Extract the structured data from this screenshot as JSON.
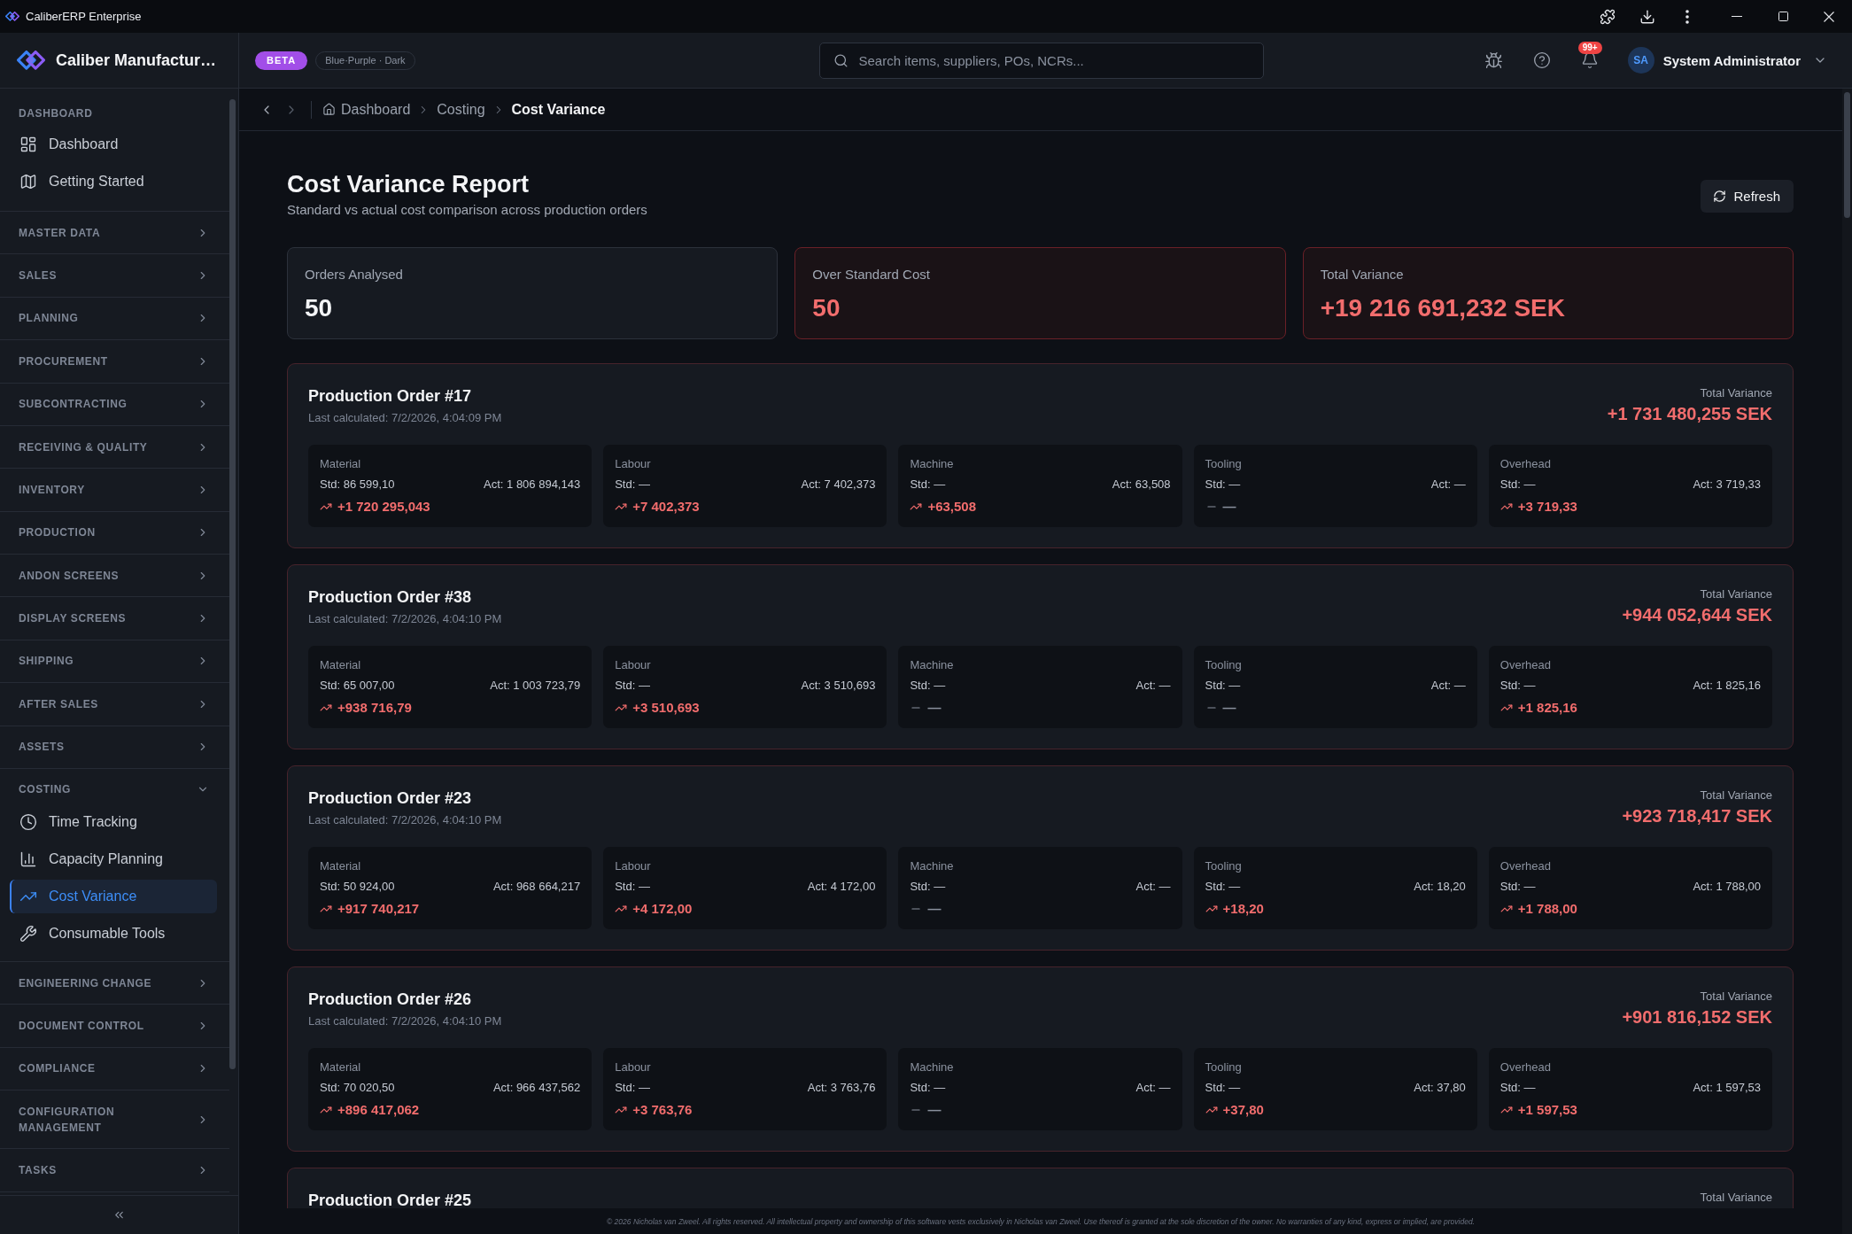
{
  "window": {
    "title": "CaliberERP Enterprise"
  },
  "sidebar": {
    "brand": "Caliber Manufactur…",
    "sections": [
      {
        "kind": "static",
        "label": "DASHBOARD",
        "items": [
          {
            "label": "Dashboard",
            "selected": false
          },
          {
            "label": "Getting Started",
            "selected": false
          }
        ]
      },
      {
        "kind": "group",
        "label": "MASTER DATA",
        "expanded": false
      },
      {
        "kind": "group",
        "label": "SALES",
        "expanded": false
      },
      {
        "kind": "group",
        "label": "PLANNING",
        "expanded": false
      },
      {
        "kind": "group",
        "label": "PROCUREMENT",
        "expanded": false
      },
      {
        "kind": "group",
        "label": "SUBCONTRACTING",
        "expanded": false
      },
      {
        "kind": "group",
        "label": "RECEIVING & QUALITY",
        "expanded": false
      },
      {
        "kind": "group",
        "label": "INVENTORY",
        "expanded": false
      },
      {
        "kind": "group",
        "label": "PRODUCTION",
        "expanded": false
      },
      {
        "kind": "group",
        "label": "ANDON SCREENS",
        "expanded": false
      },
      {
        "kind": "group",
        "label": "DISPLAY SCREENS",
        "expanded": false
      },
      {
        "kind": "group",
        "label": "SHIPPING",
        "expanded": false
      },
      {
        "kind": "group",
        "label": "AFTER SALES",
        "expanded": false
      },
      {
        "kind": "group",
        "label": "ASSETS",
        "expanded": false
      },
      {
        "kind": "group",
        "label": "COSTING",
        "expanded": true,
        "items": [
          {
            "label": "Time Tracking",
            "selected": false
          },
          {
            "label": "Capacity Planning",
            "selected": false
          },
          {
            "label": "Cost Variance",
            "selected": true
          },
          {
            "label": "Consumable Tools",
            "selected": false
          }
        ]
      },
      {
        "kind": "group",
        "label": "ENGINEERING CHANGE",
        "expanded": false
      },
      {
        "kind": "group",
        "label": "DOCUMENT CONTROL",
        "expanded": false
      },
      {
        "kind": "group",
        "label": "COMPLIANCE",
        "expanded": false
      },
      {
        "kind": "group",
        "label": "CONFIGURATION MANAGEMENT",
        "expanded": false
      },
      {
        "kind": "group",
        "label": "TASKS",
        "expanded": false
      }
    ]
  },
  "header": {
    "badge": "BETA",
    "theme_chip": "Blue·Purple · Dark",
    "search": {
      "placeholder": "Search items, suppliers, POs, NCRs..."
    },
    "notifications": {
      "count": "99+"
    },
    "user": {
      "initials": "SA",
      "name": "System Administrator"
    }
  },
  "breadcrumb": {
    "history": [
      {
        "kind": "back",
        "disabled": false
      },
      {
        "kind": "forward",
        "disabled": true
      }
    ],
    "items": [
      {
        "label": "Dashboard",
        "current": false
      },
      {
        "label": "Costing",
        "current": false
      },
      {
        "label": "Cost Variance",
        "current": true
      }
    ]
  },
  "page": {
    "title": "Cost Variance Report",
    "subtitle": "Standard vs actual cost comparison across production orders",
    "refresh_button": "Refresh"
  },
  "stats": [
    {
      "kind": "neutral",
      "label": "Orders Analysed",
      "value": "50"
    },
    {
      "kind": "alert",
      "label": "Over Standard Cost",
      "value": "50"
    },
    {
      "kind": "alert",
      "label": "Total Variance",
      "value": "+19 216 691,232 SEK"
    }
  ],
  "orders": [
    {
      "title": "Production Order #17",
      "last_calculated": "Last calculated: 7/2/2026, 4:04:09 PM",
      "total_label": "Total Variance",
      "total": "+1 731 480,255 SEK",
      "costs": [
        {
          "label": "Material",
          "std": "Std: 86 599,10",
          "act": "Act: 1 806 894,143",
          "kind": "increase",
          "variance": "+1 720 295,043"
        },
        {
          "label": "Labour",
          "std": "Std: —",
          "act": "Act: 7 402,373",
          "kind": "increase",
          "variance": "+7 402,373"
        },
        {
          "label": "Machine",
          "std": "Std: —",
          "act": "Act: 63,508",
          "kind": "increase",
          "variance": "+63,508"
        },
        {
          "label": "Tooling",
          "std": "Std: —",
          "act": "Act: —",
          "kind": "unchanged",
          "variance": "—"
        },
        {
          "label": "Overhead",
          "std": "Std: —",
          "act": "Act: 3 719,33",
          "kind": "increase",
          "variance": "+3 719,33"
        }
      ]
    },
    {
      "title": "Production Order #38",
      "last_calculated": "Last calculated: 7/2/2026, 4:04:10 PM",
      "total_label": "Total Variance",
      "total": "+944 052,644 SEK",
      "costs": [
        {
          "label": "Material",
          "std": "Std: 65 007,00",
          "act": "Act: 1 003 723,79",
          "kind": "increase",
          "variance": "+938 716,79"
        },
        {
          "label": "Labour",
          "std": "Std: —",
          "act": "Act: 3 510,693",
          "kind": "increase",
          "variance": "+3 510,693"
        },
        {
          "label": "Machine",
          "std": "Std: —",
          "act": "Act: —",
          "kind": "unchanged",
          "variance": "—"
        },
        {
          "label": "Tooling",
          "std": "Std: —",
          "act": "Act: —",
          "kind": "unchanged",
          "variance": "—"
        },
        {
          "label": "Overhead",
          "std": "Std: —",
          "act": "Act: 1 825,16",
          "kind": "increase",
          "variance": "+1 825,16"
        }
      ]
    },
    {
      "title": "Production Order #23",
      "last_calculated": "Last calculated: 7/2/2026, 4:04:10 PM",
      "total_label": "Total Variance",
      "total": "+923 718,417 SEK",
      "costs": [
        {
          "label": "Material",
          "std": "Std: 50 924,00",
          "act": "Act: 968 664,217",
          "kind": "increase",
          "variance": "+917 740,217"
        },
        {
          "label": "Labour",
          "std": "Std: —",
          "act": "Act: 4 172,00",
          "kind": "increase",
          "variance": "+4 172,00"
        },
        {
          "label": "Machine",
          "std": "Std: —",
          "act": "Act: —",
          "kind": "unchanged",
          "variance": "—"
        },
        {
          "label": "Tooling",
          "std": "Std: —",
          "act": "Act: 18,20",
          "kind": "increase",
          "variance": "+18,20"
        },
        {
          "label": "Overhead",
          "std": "Std: —",
          "act": "Act: 1 788,00",
          "kind": "increase",
          "variance": "+1 788,00"
        }
      ]
    },
    {
      "title": "Production Order #26",
      "last_calculated": "Last calculated: 7/2/2026, 4:04:10 PM",
      "total_label": "Total Variance",
      "total": "+901 816,152 SEK",
      "costs": [
        {
          "label": "Material",
          "std": "Std: 70 020,50",
          "act": "Act: 966 437,562",
          "kind": "increase",
          "variance": "+896 417,062"
        },
        {
          "label": "Labour",
          "std": "Std: —",
          "act": "Act: 3 763,76",
          "kind": "increase",
          "variance": "+3 763,76"
        },
        {
          "label": "Machine",
          "std": "Std: —",
          "act": "Act: —",
          "kind": "unchanged",
          "variance": "—"
        },
        {
          "label": "Tooling",
          "std": "Std: —",
          "act": "Act: 37,80",
          "kind": "increase",
          "variance": "+37,80"
        },
        {
          "label": "Overhead",
          "std": "Std: —",
          "act": "Act: 1 597,53",
          "kind": "increase",
          "variance": "+1 597,53"
        }
      ]
    },
    {
      "title": "Production Order #25",
      "total_label": "Total Variance"
    }
  ],
  "footer": "© 2026 Nicholas van Zweel. All rights reserved. All intellectual property and ownership of this software vests exclusively in Nicholas van Zweel. Use thereof is granted at the sole discretion of the owner. No warranties of any kind, express or implied, are provided."
}
